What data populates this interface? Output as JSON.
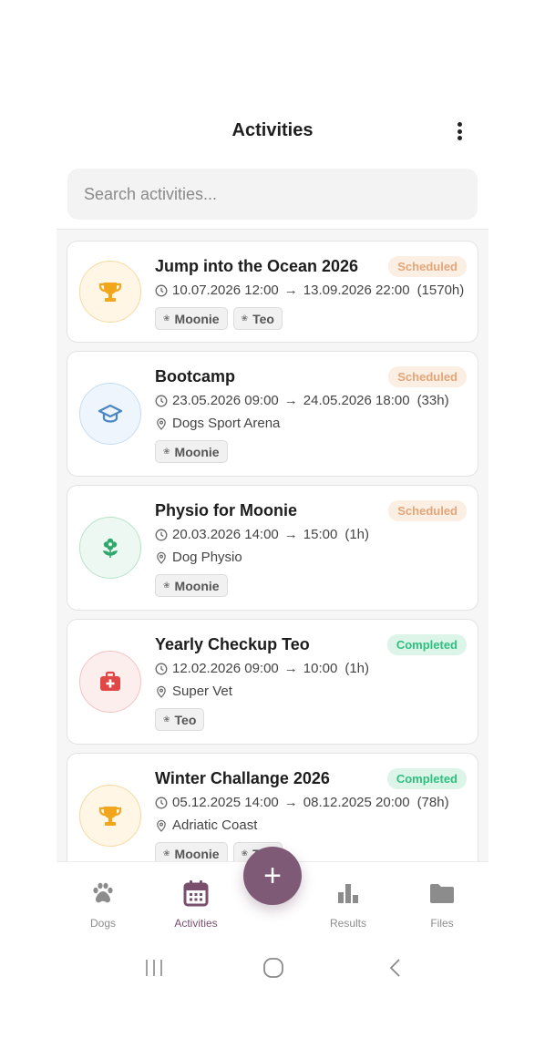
{
  "header": {
    "title": "Activities",
    "menu_icon": "kebab-menu-icon"
  },
  "search": {
    "placeholder": "Search activities..."
  },
  "activities": [
    {
      "title": "Jump into the Ocean 2026",
      "status": "Scheduled",
      "icon": "trophy-icon",
      "start": "10.07.2026 12:00",
      "end": "13.09.2026 22:00",
      "duration": "(1570h)",
      "location": "",
      "dogs": [
        "Moonie",
        "Teo"
      ]
    },
    {
      "title": "Bootcamp",
      "status": "Scheduled",
      "icon": "graduation-cap-icon",
      "start": "23.05.2026 09:00",
      "end": "24.05.2026 18:00",
      "duration": "(33h)",
      "location": "Dogs Sport Arena",
      "dogs": [
        "Moonie"
      ]
    },
    {
      "title": "Physio for Moonie",
      "status": "Scheduled",
      "icon": "flower-icon",
      "start": "20.03.2026 14:00",
      "end": "15:00",
      "duration": "(1h)",
      "location": "Dog Physio",
      "dogs": [
        "Moonie"
      ]
    },
    {
      "title": "Yearly Checkup Teo",
      "status": "Completed",
      "icon": "medical-kit-icon",
      "start": "12.02.2026 09:00",
      "end": "10:00",
      "duration": "(1h)",
      "location": "Super Vet",
      "dogs": [
        "Teo"
      ]
    },
    {
      "title": "Winter Challange 2026",
      "status": "Completed",
      "icon": "trophy-icon",
      "start": "05.12.2025 14:00",
      "end": "08.12.2025 20:00",
      "duration": "(78h)",
      "location": "Adriatic Coast",
      "dogs": [
        "Moonie",
        "Teo"
      ]
    }
  ],
  "arrow": "→",
  "nav": {
    "items": [
      {
        "label": "Dogs",
        "icon": "paw-icon",
        "active": false
      },
      {
        "label": "Activities",
        "icon": "calendar-icon",
        "active": true
      },
      {
        "label": "Results",
        "icon": "bar-chart-icon",
        "active": false
      },
      {
        "label": "Files",
        "icon": "folder-icon",
        "active": false
      }
    ],
    "fab": "+"
  },
  "colors": {
    "accent": "#7e5a76",
    "scheduled_bg": "#fbeee3",
    "scheduled_text": "#e3a679",
    "completed_bg": "#dcf5e8",
    "completed_text": "#2fbf7f",
    "trophy": "#f2a61c",
    "cap": "#4a86c5",
    "flower": "#2ea86a",
    "medical": "#e04848"
  }
}
